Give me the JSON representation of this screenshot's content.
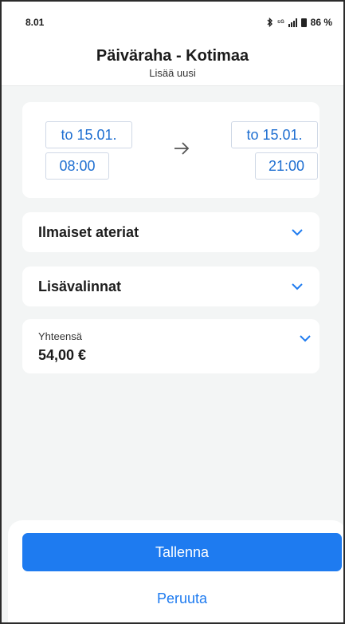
{
  "status_bar": {
    "time": "8.01",
    "network": "⁵ᴳ",
    "battery": "86 %"
  },
  "header": {
    "title": "Päiväraha - Kotimaa",
    "subtitle": "Lisää uusi"
  },
  "trip": {
    "start_date": "to 15.01.",
    "start_time": "08:00",
    "end_date": "to 15.01.",
    "end_time": "21:00"
  },
  "sections": {
    "meals_label": "Ilmaiset ateriat",
    "extras_label": "Lisävalinnat",
    "total_label": "Yhteensä",
    "total_value": "54,00 €"
  },
  "actions": {
    "save_label": "Tallenna",
    "cancel_label": "Peruuta"
  },
  "colors": {
    "accent": "#1e7bf0",
    "background": "#f3f5f5"
  }
}
